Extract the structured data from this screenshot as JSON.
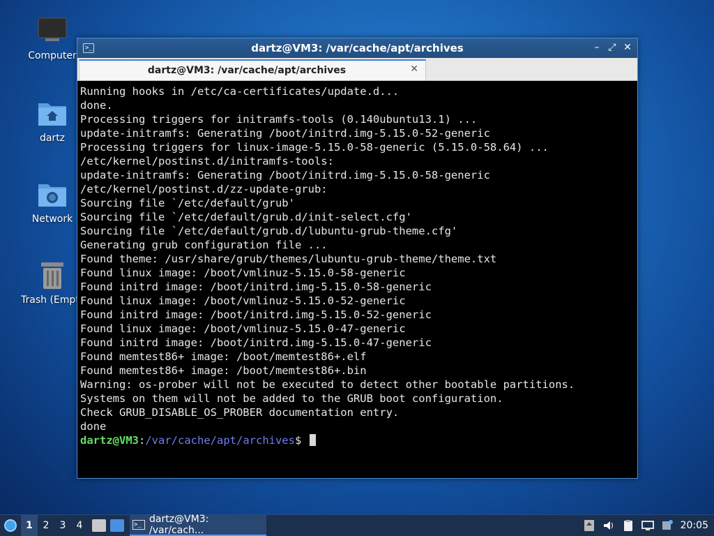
{
  "desktop": {
    "icons": [
      {
        "label": "Computer"
      },
      {
        "label": "dartz"
      },
      {
        "label": "Network"
      },
      {
        "label": "Trash (Empty)"
      }
    ]
  },
  "window": {
    "title": "dartz@VM3: /var/cache/apt/archives",
    "controls": {
      "minimize": "–",
      "maximize": "⤢",
      "close": "✕"
    },
    "tab": {
      "label": "dartz@VM3: /var/cache/apt/archives",
      "close": "✕"
    }
  },
  "terminal": {
    "lines": [
      "Running hooks in /etc/ca-certificates/update.d...",
      "done.",
      "Processing triggers for initramfs-tools (0.140ubuntu13.1) ...",
      "update-initramfs: Generating /boot/initrd.img-5.15.0-52-generic",
      "Processing triggers for linux-image-5.15.0-58-generic (5.15.0-58.64) ...",
      "/etc/kernel/postinst.d/initramfs-tools:",
      "update-initramfs: Generating /boot/initrd.img-5.15.0-58-generic",
      "/etc/kernel/postinst.d/zz-update-grub:",
      "Sourcing file `/etc/default/grub'",
      "Sourcing file `/etc/default/grub.d/init-select.cfg'",
      "Sourcing file `/etc/default/grub.d/lubuntu-grub-theme.cfg'",
      "Generating grub configuration file ...",
      "Found theme: /usr/share/grub/themes/lubuntu-grub-theme/theme.txt",
      "Found linux image: /boot/vmlinuz-5.15.0-58-generic",
      "Found initrd image: /boot/initrd.img-5.15.0-58-generic",
      "Found linux image: /boot/vmlinuz-5.15.0-52-generic",
      "Found initrd image: /boot/initrd.img-5.15.0-52-generic",
      "Found linux image: /boot/vmlinuz-5.15.0-47-generic",
      "Found initrd image: /boot/initrd.img-5.15.0-47-generic",
      "Found memtest86+ image: /boot/memtest86+.elf",
      "Found memtest86+ image: /boot/memtest86+.bin",
      "Warning: os-prober will not be executed to detect other bootable partitions.",
      "Systems on them will not be added to the GRUB boot configuration.",
      "Check GRUB_DISABLE_OS_PROBER documentation entry.",
      "done"
    ],
    "prompt": {
      "user": "dartz@VM3",
      "sep": ":",
      "path": "/var/cache/apt/archives",
      "symbol": "$ "
    }
  },
  "taskbar": {
    "workspaces": [
      "1",
      "2",
      "3",
      "4"
    ],
    "task_label": "dartz@VM3: /var/cach...",
    "clock": "20:05"
  },
  "colors": {
    "prompt_user": "#62e063",
    "prompt_path": "#6f7ef0",
    "titlebar": "#2a5c94",
    "taskbar": "#1b2f4f"
  }
}
